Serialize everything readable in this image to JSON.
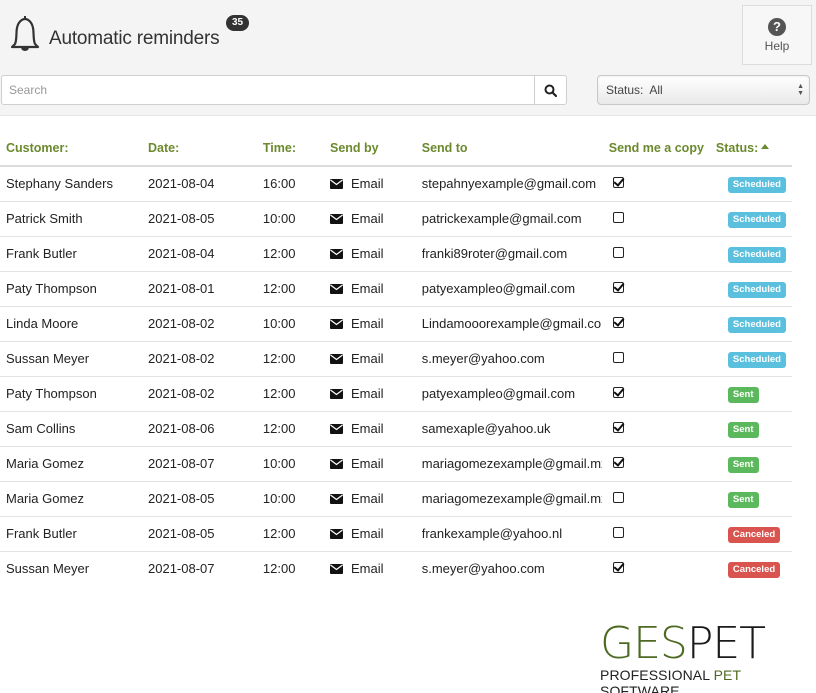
{
  "header": {
    "title": "Automatic reminders",
    "count_badge": "35",
    "bell_icon": "bell-icon",
    "help_label": "Help",
    "help_icon": "question-circle-icon"
  },
  "search": {
    "placeholder": "Search",
    "value": "",
    "button_icon": "search-icon"
  },
  "status_filter": {
    "label": "Status:",
    "selected": "All"
  },
  "table": {
    "columns": [
      "Customer:",
      "Date:",
      "Time:",
      "Send by",
      "Send to",
      "Send me a copy",
      "Status:"
    ],
    "sorted_column": "Status:",
    "sort_direction": "ascending",
    "rows": [
      {
        "customer": "Stephany Sanders",
        "date": "2021-08-04",
        "time": "16:00",
        "send_by": "Email",
        "send_to": "stepahnyexample@gmail.com",
        "copy": true,
        "status": "Scheduled"
      },
      {
        "customer": "Patrick Smith",
        "date": "2021-08-05",
        "time": "10:00",
        "send_by": "Email",
        "send_to": "patrickexample@gmail.com",
        "copy": false,
        "status": "Scheduled"
      },
      {
        "customer": "Frank Butler",
        "date": "2021-08-04",
        "time": "12:00",
        "send_by": "Email",
        "send_to": "franki89roter@gmail.com",
        "copy": false,
        "status": "Scheduled"
      },
      {
        "customer": "Paty Thompson",
        "date": "2021-08-01",
        "time": "12:00",
        "send_by": "Email",
        "send_to": "patyexampleo@gmail.com",
        "copy": true,
        "status": "Scheduled"
      },
      {
        "customer": "Linda Moore",
        "date": "2021-08-02",
        "time": "10:00",
        "send_by": "Email",
        "send_to": "Lindamooorexample@gmail.com",
        "copy": true,
        "status": "Scheduled"
      },
      {
        "customer": "Sussan Meyer",
        "date": "2021-08-02",
        "time": "12:00",
        "send_by": "Email",
        "send_to": "s.meyer@yahoo.com",
        "copy": false,
        "status": "Scheduled"
      },
      {
        "customer": "Paty Thompson",
        "date": "2021-08-02",
        "time": "12:00",
        "send_by": "Email",
        "send_to": "patyexampleo@gmail.com",
        "copy": true,
        "status": "Sent"
      },
      {
        "customer": "Sam Collins",
        "date": "2021-08-06",
        "time": "12:00",
        "send_by": "Email",
        "send_to": "samexaple@yahoo.uk",
        "copy": true,
        "status": "Sent"
      },
      {
        "customer": "Maria Gomez",
        "date": "2021-08-07",
        "time": "10:00",
        "send_by": "Email",
        "send_to": "mariagomezexample@gmail.mx",
        "copy": true,
        "status": "Sent"
      },
      {
        "customer": "Maria Gomez",
        "date": "2021-08-05",
        "time": "10:00",
        "send_by": "Email",
        "send_to": "mariagomezexample@gmail.mx",
        "copy": false,
        "status": "Sent"
      },
      {
        "customer": "Frank Butler",
        "date": "2021-08-05",
        "time": "12:00",
        "send_by": "Email",
        "send_to": "frankexample@yahoo.nl",
        "copy": false,
        "status": "Canceled"
      },
      {
        "customer": "Sussan Meyer",
        "date": "2021-08-07",
        "time": "12:00",
        "send_by": "Email",
        "send_to": "s.meyer@yahoo.com",
        "copy": true,
        "status": "Canceled"
      }
    ]
  },
  "status_colors": {
    "Scheduled": "#5bc0de",
    "Sent": "#5cb85c",
    "Canceled": "#d9534f"
  },
  "accent_color": "#6b8a2e",
  "logo": {
    "main_part1": "GES",
    "main_part2": "PET",
    "sub_part1": "PROFESSIONAL ",
    "sub_part2": "PET",
    "sub_part3": " SOFTWARE"
  }
}
